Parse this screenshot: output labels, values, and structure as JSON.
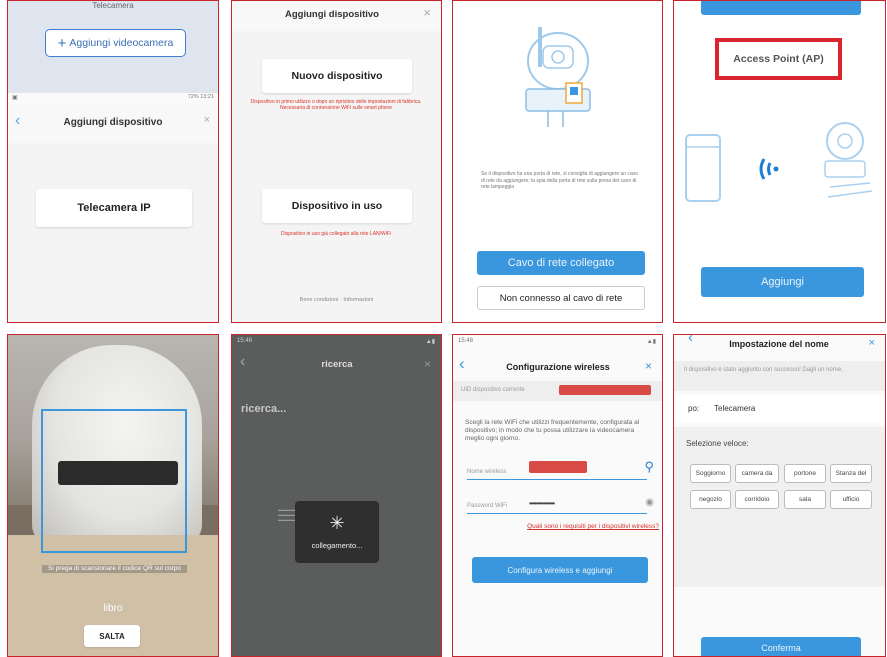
{
  "p1": {
    "top_label": "Telecamera",
    "add_camera_button": "Aggiungi videocamera",
    "status_bar": "72% 13:21",
    "title": "Aggiungi dispositivo",
    "ip_camera_button": "Telecamera IP"
  },
  "p2": {
    "title": "Aggiungi dispositivo",
    "new_device_button": "Nuovo dispositivo",
    "new_device_note": "Dispositivo in primo utilizzo o dopo un ripristino delle impostazioni di fabbrica. Necessaria di connessione WiFi sulle smart phone",
    "in_use_button": "Dispositivo in uso",
    "in_use_note": "Dispositivo in uso già collegato alla rete LAN/WiFi",
    "footer": "Bene condizioni · Informazioni"
  },
  "p3": {
    "instructions": "Se il dispositivo ha una porta di rete, si consiglia di aggiungere un cavo di rete da aggiungere; la spia della porta di rete sulla presa del cavo di rete lampeggia",
    "cable_connected_button": "Cavo di rete collegato",
    "not_connected_button": "Non connesso al cavo di rete"
  },
  "p4": {
    "mode_title": "Access Point (AP)",
    "add_button": "Aggiungi"
  },
  "p5": {
    "scan_hint": "Si prega di scansionare il codice QR sul corpo",
    "book_label": "libro",
    "skip_button": "SALTA"
  },
  "p6": {
    "status_bar": "15:48",
    "title": "ricerca",
    "searching_text": "ricerca...",
    "connecting_text": "collegamento..."
  },
  "p7": {
    "status_bar": "15:48",
    "title": "Configurazione wireless",
    "uid_label": "UID dispositivo corrente",
    "description": "Scegli la rete WiFi che utilizzi frequentemente, configurata al dispositivo; in modo che tu possa utilizzare la videocamera meglio ogni giorno.",
    "wifi_name_label": "Nome wireless",
    "wifi_password_label": "Password WiFi",
    "wifi_password_value": "••••••••••••••",
    "requirements_link": "Quali sono i requisiti per i dispositivi wireless?",
    "configure_button": "Configura wireless e aggiungi"
  },
  "p8": {
    "title": "Impostazione del nome",
    "success_note": "Il dispositivo è stato aggiunto con successo! Dagli un nome.",
    "name_prefix": "po:",
    "name_value": "Telecamera",
    "quick_select_label": "Selezione veloce:",
    "chips": [
      "Soggiorno",
      "camera da",
      "portone",
      "Stanza del",
      "negozio",
      "corridoio",
      "sala",
      "ufficio"
    ],
    "confirm_button": "Conferma"
  },
  "colors": {
    "accent_blue": "#3b97dd",
    "highlight_red": "#d9262e",
    "panel_border": "#c8242b"
  }
}
